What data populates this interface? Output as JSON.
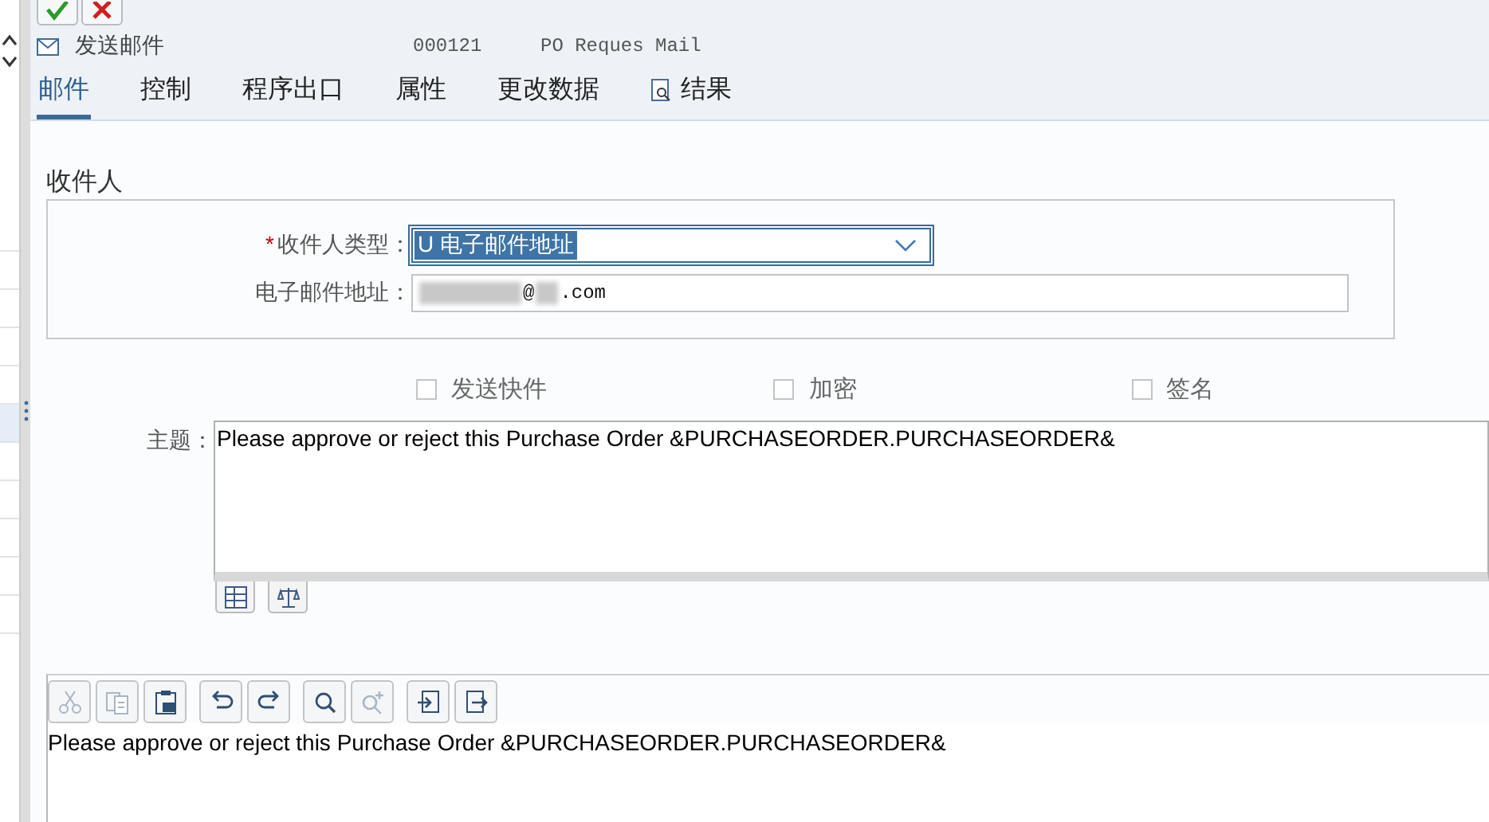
{
  "side_panel": {
    "rows": [
      {
        "selected": false
      },
      {
        "selected": false
      },
      {
        "selected": false
      },
      {
        "selected": false
      },
      {
        "selected": false
      },
      {
        "selected": true
      },
      {
        "selected": false
      },
      {
        "selected": false
      },
      {
        "selected": false
      },
      {
        "selected": false
      },
      {
        "selected": false
      }
    ]
  },
  "header": {
    "title": "发送邮件",
    "number": "000121",
    "name": "PO Reques Mail"
  },
  "tabs": [
    {
      "label": "邮件",
      "selected": true,
      "icon": false
    },
    {
      "label": "控制",
      "selected": false,
      "icon": false
    },
    {
      "label": "程序出口",
      "selected": false,
      "icon": false
    },
    {
      "label": "属性",
      "selected": false,
      "icon": false
    },
    {
      "label": "更改数据",
      "selected": false,
      "icon": false
    },
    {
      "label": "结果",
      "selected": false,
      "icon": true
    }
  ],
  "recipient": {
    "heading": "收件人",
    "type_label": "收件人类型：",
    "required_mark": "*",
    "type_value": "U 电子邮件地址",
    "email_label": "电子邮件地址：",
    "email_parts": [
      "@",
      ".com"
    ]
  },
  "options": [
    {
      "label": "发送快件",
      "checked": false
    },
    {
      "label": "加密",
      "checked": false
    },
    {
      "label": "签名",
      "checked": false
    }
  ],
  "subject": {
    "label": "主题：",
    "text": "Please approve or reject this Purchase Order &PURCHASEORDER.PURCHASEORDER&"
  },
  "editor": {
    "tools": [
      {
        "kind": "cut",
        "disabled": true
      },
      {
        "kind": "copy",
        "disabled": true
      },
      {
        "kind": "paste",
        "disabled": false
      },
      {
        "kind": "undo",
        "disabled": false
      },
      {
        "kind": "redo",
        "disabled": false
      },
      {
        "kind": "find",
        "disabled": false
      },
      {
        "kind": "find-next",
        "disabled": true
      },
      {
        "kind": "import",
        "disabled": false
      },
      {
        "kind": "export",
        "disabled": false
      }
    ],
    "text": "Please approve or reject this Purchase Order &PURCHASEORDER.PURCHASEORDER&"
  }
}
